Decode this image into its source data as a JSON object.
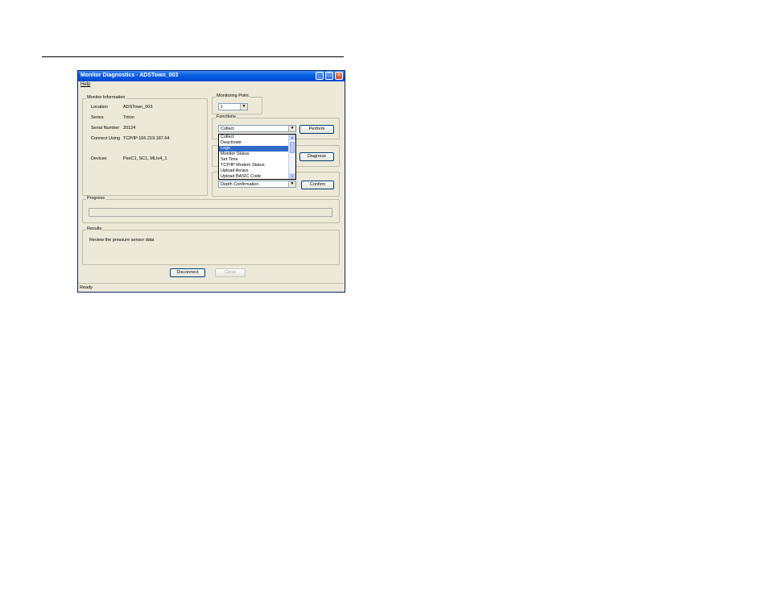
{
  "window": {
    "title": "Monitor Diagnostics - ADSTown_003"
  },
  "menu": {
    "help": "Help"
  },
  "monitor_info": {
    "group_label": "Monitor Information",
    "rows": [
      {
        "label": "Location",
        "value": "ADSTown_003"
      },
      {
        "label": "Series",
        "value": "Triton"
      },
      {
        "label": "Serial Number",
        "value": "20124"
      },
      {
        "label": "Connect Using",
        "value": "TCP/IP:166.219.187.64"
      },
      {
        "label": "Devices",
        "value": "PsoC1, SC1, MLIv4_1"
      }
    ]
  },
  "monitoring_point": {
    "group_label": "Monitoring Point",
    "value": "1"
  },
  "functions": {
    "group_label": "Functions",
    "selected": "Collect",
    "button": "Perform",
    "options": [
      "Collect",
      "Deactivate",
      "Logs",
      "Monitor Status",
      "Set Time",
      "TCP/IP Modem Status",
      "Upload Arrays",
      "Upload BASIC Code"
    ],
    "highlighted_index": 2
  },
  "diagnose": {
    "button": "Diagnose"
  },
  "confirm": {
    "selected": "Depth Confirmation",
    "button": "Confirm"
  },
  "progress": {
    "group_label": "Progress"
  },
  "results": {
    "group_label": "Results",
    "text": "Review the pressure sensor data"
  },
  "footer": {
    "disconnect": "Disconnect",
    "close": "Close"
  },
  "statusbar": {
    "text": "Ready"
  }
}
